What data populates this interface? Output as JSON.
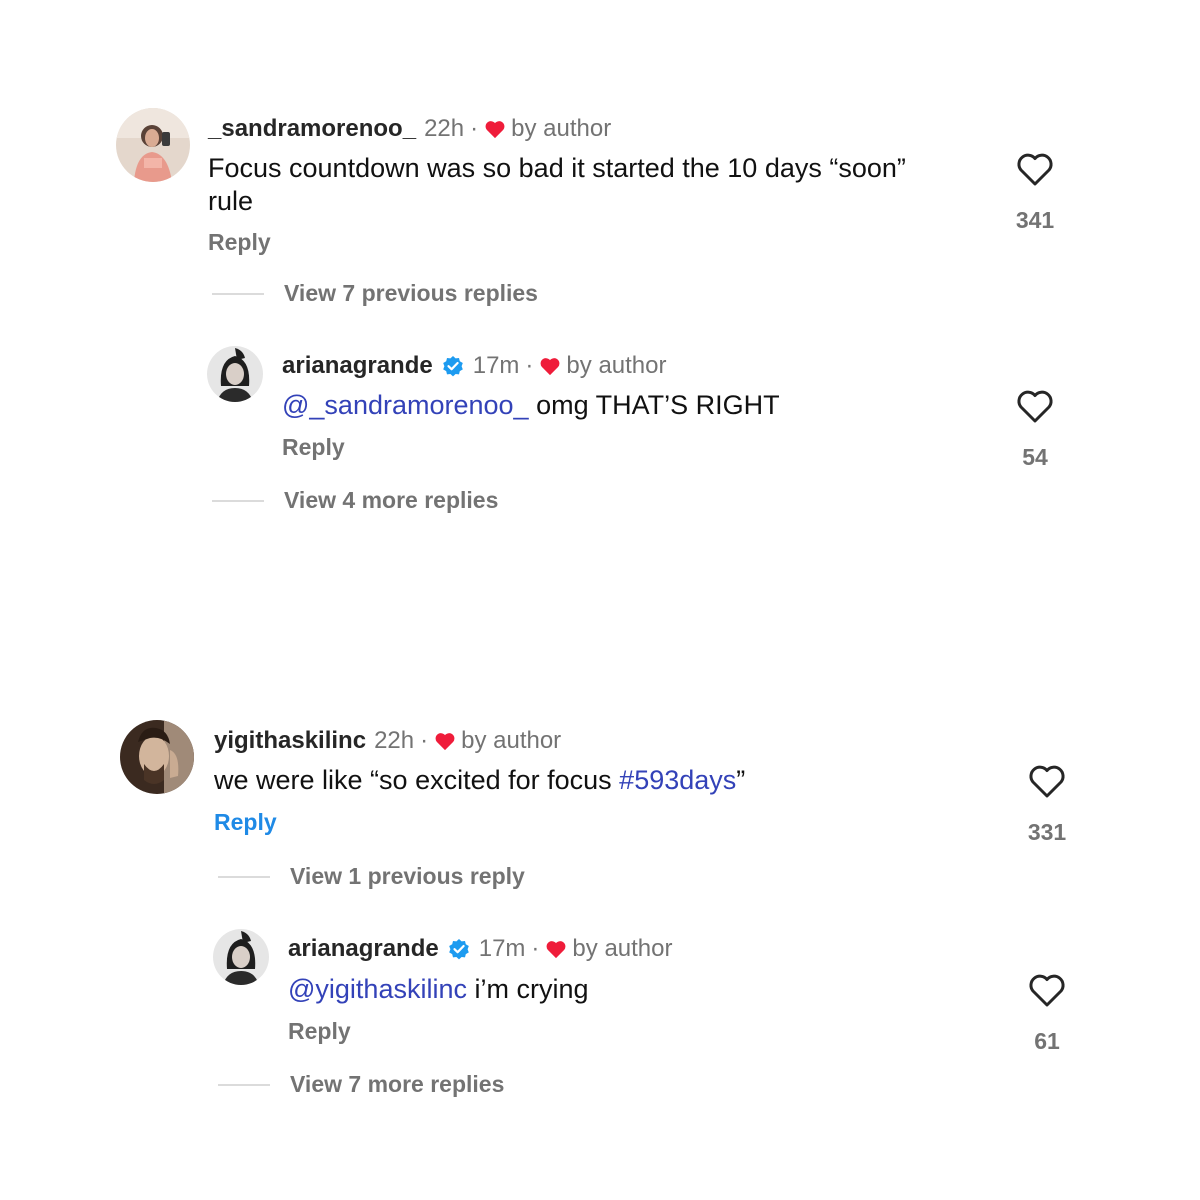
{
  "threads": [
    {
      "comment": {
        "username": "_sandramorenoo_",
        "time": "22h",
        "by_author": "by author",
        "text_lines": [
          "Focus countdown was so bad it started the 10 days “soon”",
          "rule"
        ],
        "reply": "Reply",
        "likes": "341"
      },
      "view_previous": "View 7 previous replies",
      "author_reply": {
        "username": "arianagrande",
        "time": "17m",
        "by_author": "by author",
        "mention": "@_sandramorenoo_",
        "text": " omg THAT’S RIGHT",
        "reply": "Reply",
        "likes": "54"
      },
      "view_more": "View 4 more replies"
    },
    {
      "comment": {
        "username": "yigithaskilinc",
        "time": "22h",
        "by_author": "by author",
        "text_before": "we were like “so excited for focus ",
        "hashtag": "#593days",
        "text_after": "”",
        "reply": "Reply",
        "likes": "331"
      },
      "view_previous": "View 1 previous reply",
      "author_reply": {
        "username": "arianagrande",
        "time": "17m",
        "by_author": "by author",
        "mention": "@yigithaskilinc",
        "text": " i’m crying",
        "reply": "Reply",
        "likes": "61"
      },
      "view_more": "View 7 more replies"
    }
  ],
  "colors": {
    "heart_red": "#ef1c3a",
    "verified_blue": "#1d9bf0",
    "mention_blue": "#3342b8",
    "reply_blue": "#1f8ae6",
    "muted": "#737373"
  },
  "icons": [
    "heart-outline-icon",
    "heart-filled-icon",
    "verified-badge-icon",
    "avatar"
  ]
}
